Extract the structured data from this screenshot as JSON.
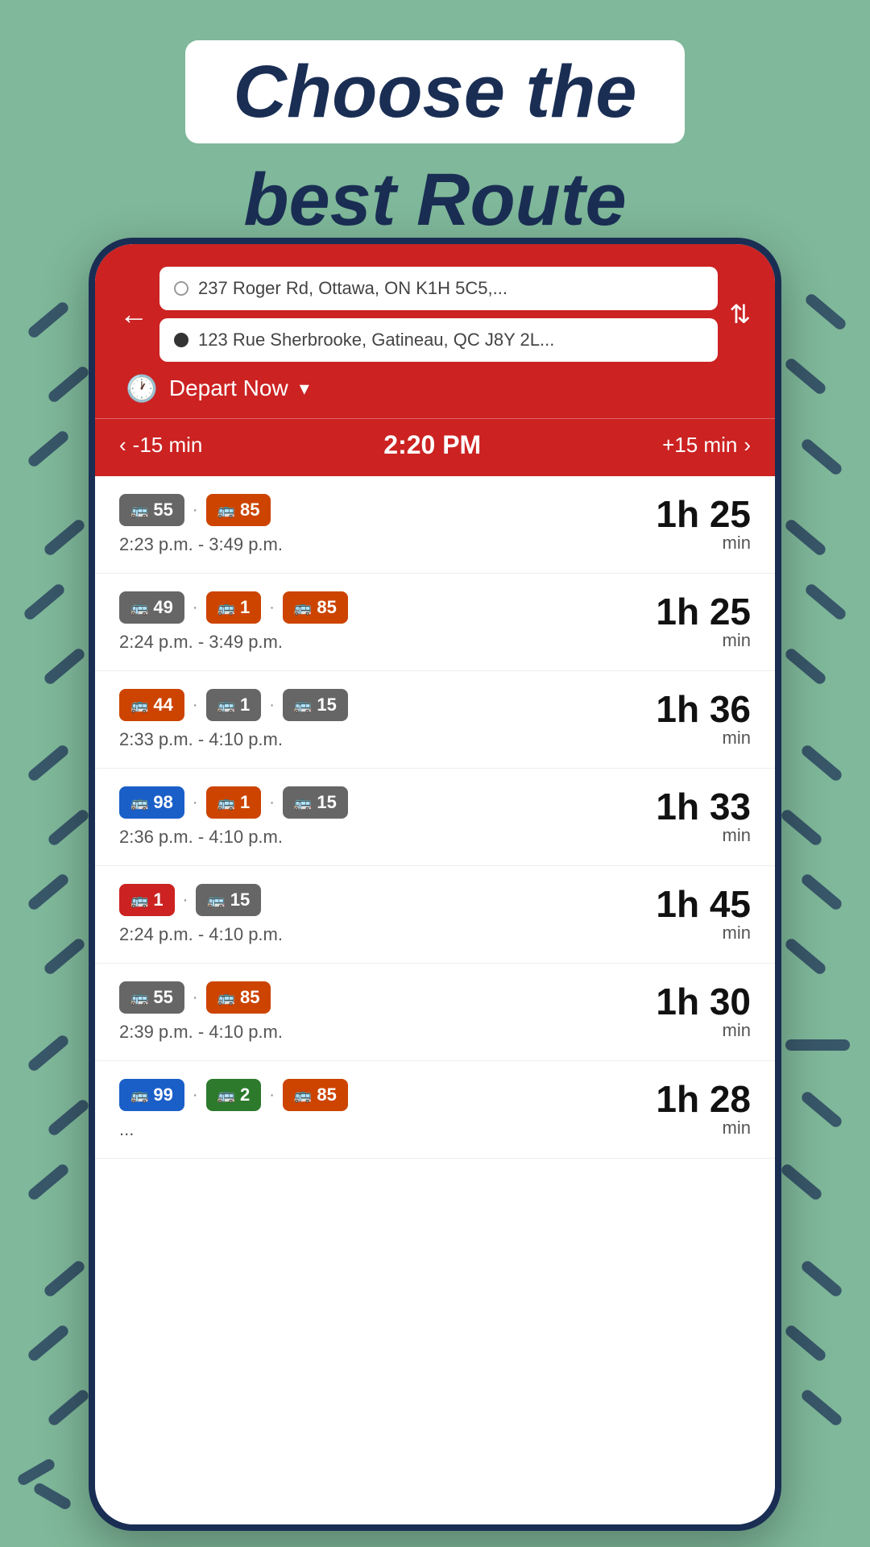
{
  "page": {
    "background_color": "#7fb89a",
    "heading_line1": "Choose the",
    "heading_line2": "best Route"
  },
  "app": {
    "back_label": "←",
    "origin": "237 Roger Rd, Ottawa, ON K1H 5C5,...",
    "destination": "123 Rue Sherbrooke, Gatineau, QC J8Y 2L...",
    "depart_label": "Depart Now",
    "time_minus": "-15 min",
    "time_current": "2:20 PM",
    "time_plus": "+15 min"
  },
  "routes": [
    {
      "badges": [
        {
          "number": "55",
          "color": "gray"
        },
        {
          "number": "85",
          "color": "orange"
        }
      ],
      "time_range": "2:23 p.m. - 3:49 p.m.",
      "duration_h": "1h 25",
      "duration_min": "min"
    },
    {
      "badges": [
        {
          "number": "49",
          "color": "gray"
        },
        {
          "number": "1",
          "color": "orange"
        },
        {
          "number": "85",
          "color": "orange"
        }
      ],
      "time_range": "2:24 p.m. - 3:49 p.m.",
      "duration_h": "1h 25",
      "duration_min": "min"
    },
    {
      "badges": [
        {
          "number": "44",
          "color": "orange"
        },
        {
          "number": "1",
          "color": "gray"
        },
        {
          "number": "15",
          "color": "gray"
        }
      ],
      "time_range": "2:33 p.m. - 4:10 p.m.",
      "duration_h": "1h 36",
      "duration_min": "min"
    },
    {
      "badges": [
        {
          "number": "98",
          "color": "blue"
        },
        {
          "number": "1",
          "color": "orange"
        },
        {
          "number": "15",
          "color": "gray"
        }
      ],
      "time_range": "2:36 p.m. - 4:10 p.m.",
      "duration_h": "1h 33",
      "duration_min": "min"
    },
    {
      "badges": [
        {
          "number": "1",
          "color": "red"
        },
        {
          "number": "15",
          "color": "gray"
        }
      ],
      "time_range": "2:24 p.m. - 4:10 p.m.",
      "duration_h": "1h 45",
      "duration_min": "min"
    },
    {
      "badges": [
        {
          "number": "55",
          "color": "gray"
        },
        {
          "number": "85",
          "color": "orange"
        }
      ],
      "time_range": "2:39 p.m. - 4:10 p.m.",
      "duration_h": "1h 30",
      "duration_min": "min"
    },
    {
      "badges": [
        {
          "number": "99",
          "color": "blue"
        },
        {
          "number": "2",
          "color": "green"
        },
        {
          "number": "85",
          "color": "orange"
        }
      ],
      "time_range": "...",
      "duration_h": "1h 28",
      "duration_min": "min"
    }
  ]
}
